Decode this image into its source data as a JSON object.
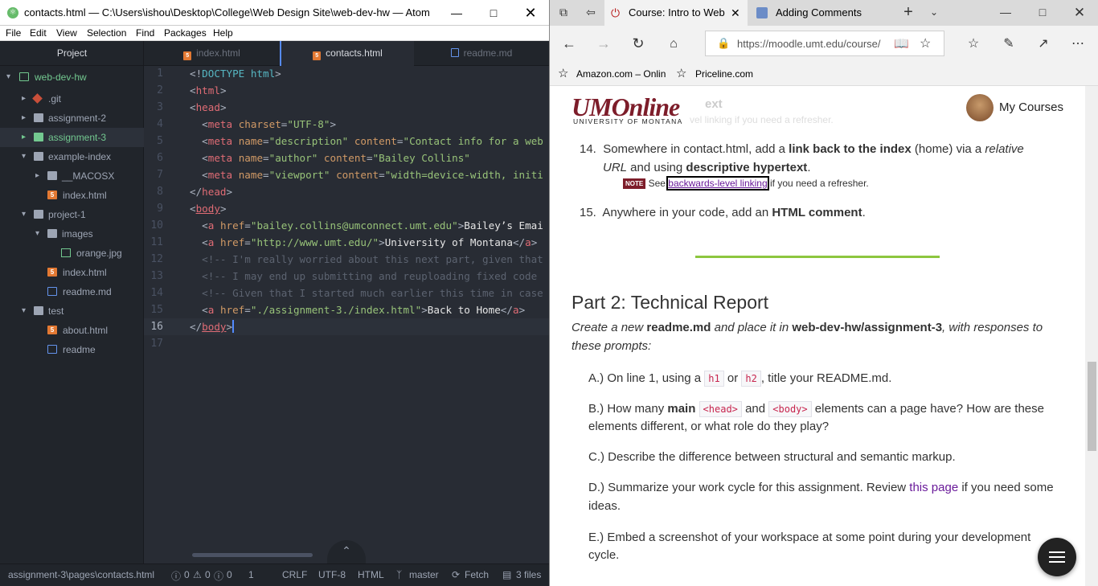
{
  "atom": {
    "window_title": "contacts.html — C:\\Users\\ishou\\Desktop\\College\\Web Design Site\\web-dev-hw — Atom",
    "menu": [
      "File",
      "Edit",
      "View",
      "Selection",
      "Find",
      "Packages",
      "Help"
    ],
    "tree_title": "Project",
    "tree": [
      {
        "label": "web-dev-hw",
        "type": "root"
      },
      {
        "label": ".git",
        "type": "git"
      },
      {
        "label": "assignment-2",
        "type": "folder"
      },
      {
        "label": "assignment-3",
        "type": "folder-selected"
      },
      {
        "label": "example-index",
        "type": "folder-open"
      },
      {
        "label": "__MACOSX",
        "type": "folder"
      },
      {
        "label": "index.html",
        "type": "html"
      },
      {
        "label": "project-1",
        "type": "folder-open"
      },
      {
        "label": "images",
        "type": "folder-open"
      },
      {
        "label": "orange.jpg",
        "type": "image"
      },
      {
        "label": "index.html",
        "type": "html"
      },
      {
        "label": "readme.md",
        "type": "md"
      },
      {
        "label": "test",
        "type": "folder-open"
      },
      {
        "label": "about.html",
        "type": "html"
      },
      {
        "label": "readme",
        "type": "md"
      }
    ],
    "tabs": [
      "index.html",
      "contacts.html",
      "readme.md"
    ],
    "line_numbers": [
      "1",
      "2",
      "3",
      "4",
      "5",
      "6",
      "7",
      "8",
      "9",
      "10",
      "11",
      "12",
      "13",
      "14",
      "15",
      "16",
      "17"
    ],
    "code": {
      "l1a": "<!",
      "l1b": "DOCTYPE",
      "l1c": " html",
      ">": ">",
      "doctype_end": ">",
      "l2": "html",
      "l3": "head",
      "meta": "meta",
      "charset": "charset",
      "utf8": "\"UTF-8\"",
      "name": "name",
      "content": "content",
      "desc": "\"description\"",
      "desc_content": "\"Contact info for a web",
      "author": "\"author\"",
      "author_content": "\"Bailey Collins\"",
      "viewport": "\"viewport\"",
      "vp_content": "\"width=device-width, initi",
      "body": "body",
      "a": "a",
      "href": "href",
      "href1": "\"bailey.collins@umconnect.umt.edu\"",
      "text1": "Bailey’s Emai",
      "href2": "\"http://www.umt.edu/\"",
      "text2": "University of Montana",
      "c12": "<!-- I'm really worried about this next part, given that",
      "c13": "<!-- I may end up submitting and reuploading fixed code",
      "c14": "<!-- Given that I started much earlier this time in case",
      "href3": "\"./assignment-3./index.html\"",
      "text3": "Back to Home"
    },
    "status": {
      "path": "assignment-3\\pages\\contacts.html",
      "diagnostics": "0",
      "warnings": "0",
      "infos": "0",
      "line": "1",
      "eol": "CRLF",
      "enc": "UTF-8",
      "grammar": "HTML",
      "branch": "master",
      "fetch": "Fetch",
      "files": "3 files"
    }
  },
  "edge": {
    "tabs": [
      "Course: Intro to Web",
      "Adding Comments"
    ],
    "url": "https://moodle.umt.edu/course/",
    "favorites": [
      "Amazon.com – Onlin",
      "Priceline.com"
    ],
    "logo_top": "UMOnline",
    "logo_sub": "UNIVERSITY OF MONTANA",
    "my_courses": "My Courses",
    "ghost_a": "ext",
    "ghost_b": "vel linking if you need a refresher.",
    "item14": {
      "num": "14.",
      "t1": "Somewhere in contact.html, add a ",
      "b1": "link back to the index",
      "t2": " (home) via a ",
      "i1": "relative",
      "i2": "URL",
      "t3": " and using ",
      "b2": "descriptive hypertext",
      "t4": ".",
      "note_badge": "NOTE",
      "note_see": "See ",
      "note_link": "backwards-level linking",
      "note_end": " if you need a refresher."
    },
    "item15": {
      "num": "15.",
      "t1": "Anywhere in your code, add an ",
      "b1": "HTML comment",
      "t2": "."
    },
    "part2_title": "Part 2: Technical Report",
    "part2_intro": {
      "i1": "Create a new ",
      "b1": "readme.md",
      "i2": " and place it in ",
      "b2": "web-dev-hw/assignment-3",
      "i3": ", with responses to",
      "i4": "these prompts:"
    },
    "qa": {
      "a": "A.) On line 1, using a ",
      "code1": "h1",
      "or": " or ",
      "code2": "h2",
      "rest": ", title your README.md."
    },
    "qb": {
      "a": "B.) How many ",
      "b": "main",
      "code1": "<head>",
      "and": " and ",
      "code2": "<body>",
      "rest": " elements can a page have? How are these",
      "line2": "elements different, or what role do they play?"
    },
    "qc": "C.) Describe the difference between structural and semantic markup.",
    "qd": {
      "a": "D.) Summarize your work cycle for this assignment. Review ",
      "link": "this page",
      "rest": " if you need some",
      "line2": "ideas."
    },
    "qe": {
      "a": "E.) Embed a screenshot of your workspace at some point during your development",
      "line2": "cycle."
    },
    "colors": {
      "brand": "#7d1d2a",
      "divider": "#8dc63f",
      "link": "#6a1b9a",
      "accent_atom": "#568af2"
    }
  }
}
